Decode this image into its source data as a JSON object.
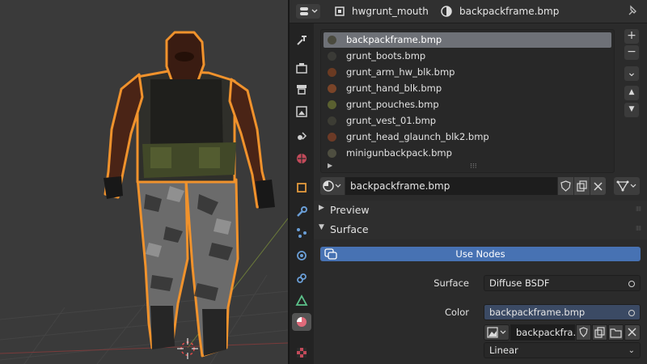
{
  "header": {
    "object_name": "hwgrunt_mouth",
    "material_name": "backpackframe.bmp"
  },
  "tabs": [
    "tool",
    "render",
    "output",
    "view-layer",
    "scene",
    "world",
    "object",
    "modifiers",
    "particles",
    "physics",
    "constraints",
    "object-data",
    "material",
    "texture"
  ],
  "material_slots": [
    {
      "label": "backpackframe.bmp",
      "color": "#4a4a3e",
      "active": true
    },
    {
      "label": "grunt_boots.bmp",
      "color": "#3a3a36",
      "active": false
    },
    {
      "label": "grunt_arm_hw_blk.bmp",
      "color": "#6a3a22",
      "active": false
    },
    {
      "label": "grunt_hand_blk.bmp",
      "color": "#7a4428",
      "active": false
    },
    {
      "label": "grunt_pouches.bmp",
      "color": "#5a6030",
      "active": false
    },
    {
      "label": "grunt_vest_01.bmp",
      "color": "#3c3c34",
      "active": false
    },
    {
      "label": "grunt_head_glaunch_blk2.bmp",
      "color": "#6c3a26",
      "active": false
    },
    {
      "label": "minigunbackpack.bmp",
      "color": "#4e4e40",
      "active": false
    }
  ],
  "side_buttons": {
    "add": "+",
    "remove": "−",
    "menu": "⌄",
    "up": "▲",
    "down": "▼"
  },
  "material_field": {
    "name": "backpackframe.bmp"
  },
  "panels": {
    "preview": "Preview",
    "surface": "Surface"
  },
  "use_nodes_label": "Use Nodes",
  "surface_prop": {
    "label": "Surface",
    "value": "Diffuse BSDF"
  },
  "color_prop": {
    "label": "Color",
    "value": "backpackframe.bmp"
  },
  "image_row": {
    "name": "backpackfra..."
  },
  "interpolation": {
    "value": "Linear"
  },
  "colors": {
    "accent": "#4772b3",
    "selection_outline": "#f0922c",
    "active_slot": "#6e7177"
  }
}
